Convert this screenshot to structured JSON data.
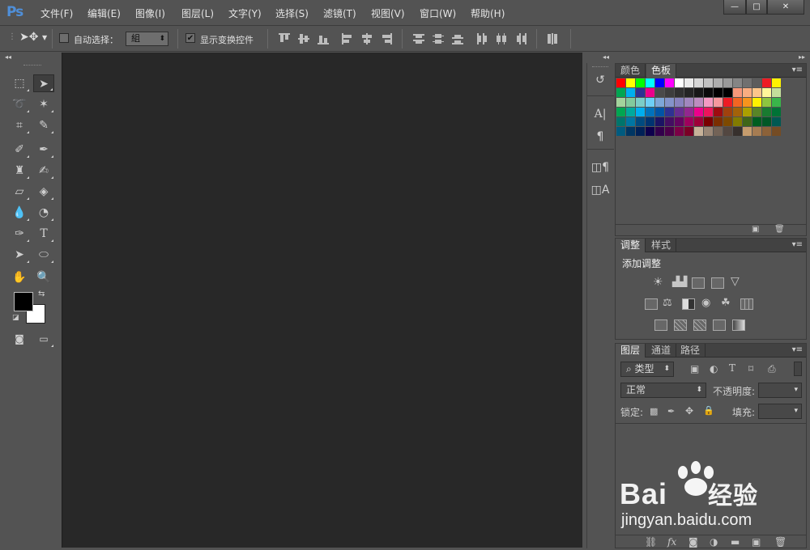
{
  "app": {
    "logo": "Ps"
  },
  "menu": [
    "文件(F)",
    "编辑(E)",
    "图像(I)",
    "图层(L)",
    "文字(Y)",
    "选择(S)",
    "滤镜(T)",
    "视图(V)",
    "窗口(W)",
    "帮助(H)"
  ],
  "window_controls": {
    "minimize": "—",
    "maximize": "□",
    "close": "✕"
  },
  "options_bar": {
    "auto_select_label": "自动选择：",
    "auto_select_checked": false,
    "auto_select_value": "組",
    "show_transform_label": "显示变换控件",
    "show_transform_checked": true
  },
  "tools": [
    [
      "marquee",
      "move"
    ],
    [
      "lasso",
      "magic-wand"
    ],
    [
      "crop",
      "eyedropper"
    ],
    [
      "spot-healing",
      "brush"
    ],
    [
      "clone-stamp",
      "history-brush"
    ],
    [
      "eraser",
      "paint-bucket"
    ],
    [
      "blur",
      "dodge"
    ],
    [
      "pen",
      "type"
    ],
    [
      "path-selection",
      "ellipse"
    ],
    [
      "hand",
      "zoom"
    ]
  ],
  "colors": {
    "foreground": "#000000",
    "background": "#ffffff",
    "accent": "#4f8fd9",
    "canvas_bg": "#282828"
  },
  "dock_icons": [
    "history-icon",
    "character-icon",
    "paragraph-icon",
    "character-styles-icon",
    "paragraph-styles-icon"
  ],
  "swatches_panel": {
    "tabs": [
      "颜色",
      "色板"
    ],
    "active_tab": 1,
    "swatches": [
      [
        "#ff0000",
        "#ffff00",
        "#00ff00",
        "#00ffff",
        "#0000ff",
        "#ff00ff",
        "#ffffff",
        "#ebebeb",
        "#d6d6d6",
        "#c2c2c2",
        "#adadad",
        "#999999",
        "#858585",
        "#707070",
        "#5c5c5c",
        "#ed1c24",
        "#fff200"
      ],
      [
        "#00a651",
        "#00aeef",
        "#2e3192",
        "#ec008c",
        "#4a4a4a",
        "#3d3d3d",
        "#303030",
        "#242424",
        "#171717",
        "#0a0a0a",
        "#000000",
        "#000000",
        "#f7977a",
        "#f9ad81",
        "#fdc68a",
        "#fff79a",
        "#c4df9b"
      ],
      [
        "#a3d39c",
        "#82ca9d",
        "#7bcdc8",
        "#6ecff6",
        "#7ea7d8",
        "#8493ca",
        "#8882be",
        "#a187be",
        "#bc8dbf",
        "#f49ac2",
        "#f6989d",
        "#ed1c24",
        "#f26522",
        "#f7941d",
        "#fff200",
        "#8dc63f",
        "#39b54a"
      ],
      [
        "#00a651",
        "#00a99d",
        "#00aeef",
        "#0072bc",
        "#0054a6",
        "#2e3192",
        "#662d91",
        "#92278f",
        "#ec008c",
        "#ed145b",
        "#9e0b0f",
        "#a0410d",
        "#a36209",
        "#aba000",
        "#598527",
        "#197b30",
        "#007236"
      ],
      [
        "#00746b",
        "#0076a3",
        "#004b80",
        "#003471",
        "#1b1464",
        "#440e62",
        "#630460",
        "#9e005d",
        "#9e0039",
        "#790000",
        "#7b2e00",
        "#7d4900",
        "#827b00",
        "#406618",
        "#005e20",
        "#005826",
        "#005952"
      ],
      [
        "#005b7f",
        "#003663",
        "#002157",
        "#0d004c",
        "#32004b",
        "#4b0049",
        "#7b0046",
        "#7a0026",
        "#c7b299",
        "#998675",
        "#736357",
        "#534741",
        "#37302d",
        "#c69c6d",
        "#a67c52",
        "#8c6239",
        "#754c24"
      ]
    ]
  },
  "adjustments_panel": {
    "tabs": [
      "调整",
      "样式"
    ],
    "active_tab": 0,
    "title": "添加调整",
    "icon_rows": [
      [
        "brightness-contrast-icon",
        "levels-icon",
        "curves-icon",
        "exposure-icon",
        "vibrance-icon"
      ],
      [
        "hue-saturation-icon",
        "color-balance-icon",
        "black-white-icon",
        "photo-filter-icon",
        "channel-mixer-icon",
        "color-lookup-icon"
      ],
      [
        "invert-icon",
        "posterize-icon",
        "threshold-icon",
        "selective-color-icon",
        "gradient-map-icon"
      ]
    ]
  },
  "layers_panel": {
    "tabs": [
      "图层",
      "通道",
      "路径"
    ],
    "active_tab": 0,
    "filter_label": "类型",
    "blend_mode": "正常",
    "opacity_label": "不透明度:",
    "lock_label": "锁定:",
    "fill_label": "填充:",
    "footer_icons": [
      "link-icon",
      "fx-icon",
      "mask-icon",
      "adjustment-layer-icon",
      "group-folder-icon",
      "new-layer-icon",
      "trash-icon"
    ]
  },
  "watermark": {
    "brand": "Bai",
    "brand2": "经验",
    "url": "jingyan.baidu.com"
  }
}
